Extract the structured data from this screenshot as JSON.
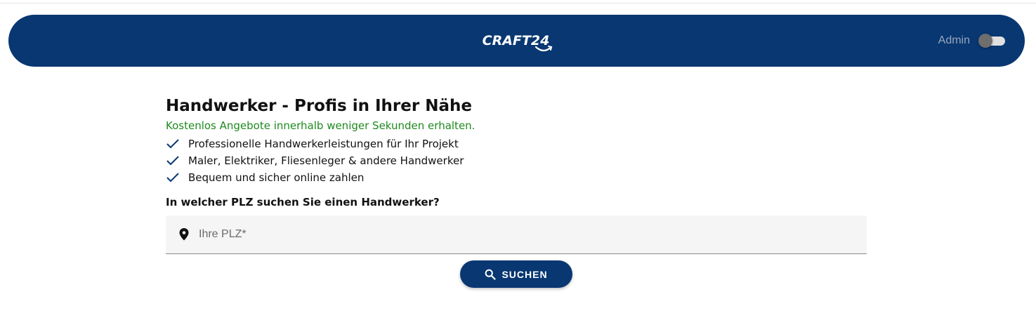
{
  "theme": {
    "primary": "#083772",
    "success_green": "#1e8a1e",
    "check_color": "#083772"
  },
  "header": {
    "logo_text": "CRAFT24",
    "admin_label": "Admin",
    "admin_toggle_on": false
  },
  "hero": {
    "title_bold": "Handwerker",
    "title_rest": " - Profis in Ihrer Nähe",
    "tagline": "Kostenlos Angebote innerhalb weniger Sekunden erhalten.",
    "features": [
      {
        "icon": "check-icon",
        "text": "Professionelle Handwerkerleistungen für Ihr Projekt"
      },
      {
        "icon": "check-icon",
        "text": "Maler, Elektriker, Fliesenleger & andere Handwerker"
      },
      {
        "icon": "check-icon",
        "text": "Bequem und sicher online zahlen"
      }
    ],
    "question": "In welcher PLZ suchen Sie einen Handwerker?"
  },
  "search": {
    "plz_value": "",
    "plz_placeholder": "Ihre PLZ*",
    "button_label": "SUCHEN",
    "button_icon": "search-icon",
    "field_icon": "location-pin-icon"
  }
}
